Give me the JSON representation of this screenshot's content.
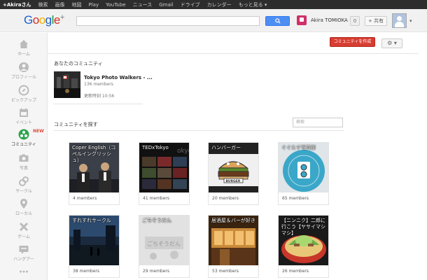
{
  "topbar": {
    "items": [
      "+Akiraさん",
      "検索",
      "画像",
      "地図",
      "Play",
      "YouTube",
      "ニュース",
      "Gmail",
      "ドライブ",
      "カレンダー",
      "もっと見る ▾"
    ]
  },
  "header": {
    "search_button_icon": "search-icon",
    "user_name": "Akira TOMIOKA",
    "notification_count": "0",
    "share_label": "+ 共有"
  },
  "sidebar": {
    "items": [
      {
        "label": "ホーム",
        "icon": "home-icon"
      },
      {
        "label": "プロフィール",
        "icon": "profile-icon"
      },
      {
        "label": "ピックアップ",
        "icon": "compass-icon"
      },
      {
        "label": "イベント",
        "icon": "calendar-icon"
      },
      {
        "label": "コミュニティ",
        "icon": "communities-icon"
      },
      {
        "label": "写真",
        "icon": "camera-icon"
      },
      {
        "label": "サークル",
        "icon": "circles-icon"
      },
      {
        "label": "ローカル",
        "icon": "pin-icon"
      },
      {
        "label": "ゲーム",
        "icon": "games-icon"
      },
      {
        "label": "ハングアー",
        "icon": "hangout-icon"
      }
    ],
    "new_badge": "NEW"
  },
  "main": {
    "create_button": "コミュニティを作成",
    "your_communities_title": "あなたのコミュニティ",
    "joined": {
      "name": "Tokyo Photo Walkers - ...",
      "members": "136 members",
      "updated": "更新時刻 10:56"
    },
    "explore_title": "コミュニティを探す",
    "explore_search_placeholder": "検索",
    "cards": [
      {
        "title": "Coper English（コペルイングリッシュ）",
        "members": "4 members"
      },
      {
        "title": "TEDxTokyo",
        "members": "41 members"
      },
      {
        "title": "ハンバーガー",
        "members": "20 members"
      },
      {
        "title": "ぐぐたす写真部",
        "members": "65 members"
      },
      {
        "title": "すれすれサークル",
        "members": "38 members"
      },
      {
        "title": "ごちそうだん",
        "members": "29 members"
      },
      {
        "title": "居酒屋＆バーが好き",
        "members": "53 members"
      },
      {
        "title": "【ニンニク】二郎に行こう【ヤサイマシマシ】",
        "members": "26 members"
      }
    ]
  },
  "colors": {
    "create_button": "#d73d32",
    "search_button": "#4d8ef2",
    "topbar": "#2d2d2d"
  }
}
